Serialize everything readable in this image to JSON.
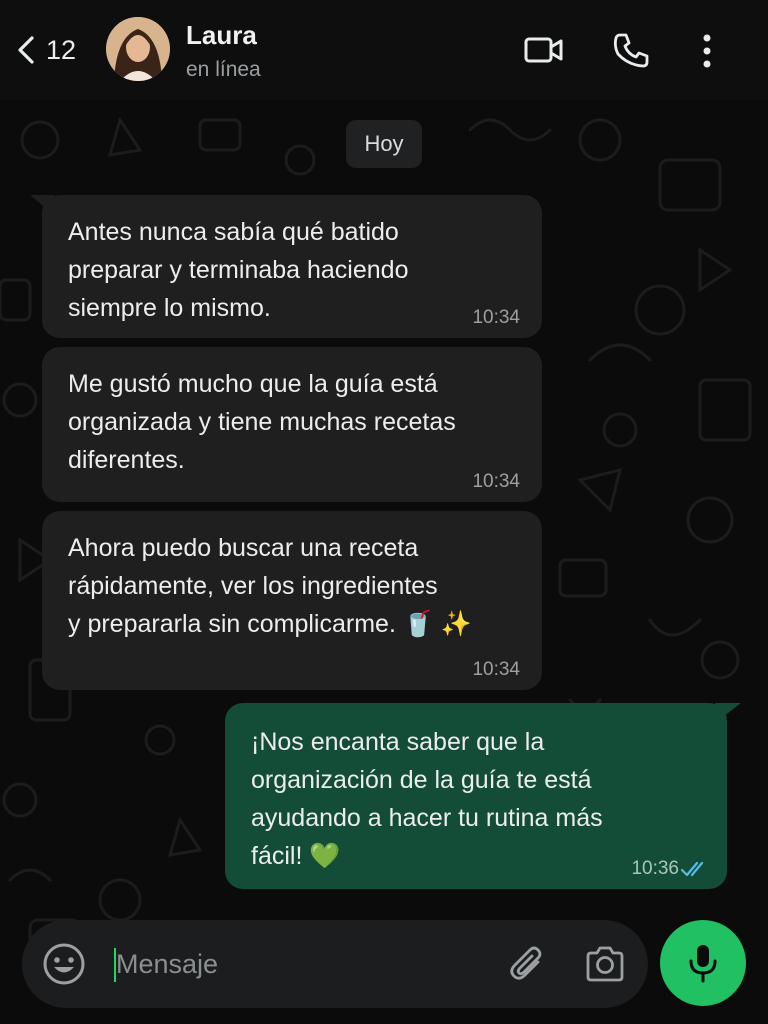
{
  "header": {
    "back_count": "12",
    "contact_name": "Laura",
    "contact_status": "en línea",
    "icons": [
      "chevron-left-icon",
      "video-icon",
      "phone-icon",
      "more-vertical-icon"
    ]
  },
  "chat": {
    "date_chip": "Hoy",
    "messages": [
      {
        "direction": "incoming",
        "text": "Antes nunca sabía qué batido\npreparar y terminaba haciendo\nsiempre lo mismo.",
        "time": "10:34"
      },
      {
        "direction": "incoming",
        "text": "Me gustó mucho que la guía está\norganizada y tiene muchas recetas\ndiferentes.",
        "time": "10:34"
      },
      {
        "direction": "incoming",
        "text": "Ahora puedo buscar una receta\nrápidamente, ver los ingredientes\ny prepararla sin complicarme. 🥤 ✨",
        "time": "10:34"
      },
      {
        "direction": "outgoing",
        "text": "¡Nos encanta saber que la\norganización de la guía te está\nayudando a hacer tu rutina más\nfácil! 💚",
        "time": "10:36",
        "status": "read"
      }
    ]
  },
  "composer": {
    "placeholder": "Mensaje",
    "icons": [
      "emoji-icon",
      "paperclip-icon",
      "camera-icon",
      "microphone-icon"
    ]
  },
  "colors": {
    "background": "#0b0b0b",
    "incoming_bubble": "#1f1f1f",
    "outgoing_bubble": "#144d37",
    "accent_green": "#21c063",
    "read_tick": "#53bdeb"
  }
}
